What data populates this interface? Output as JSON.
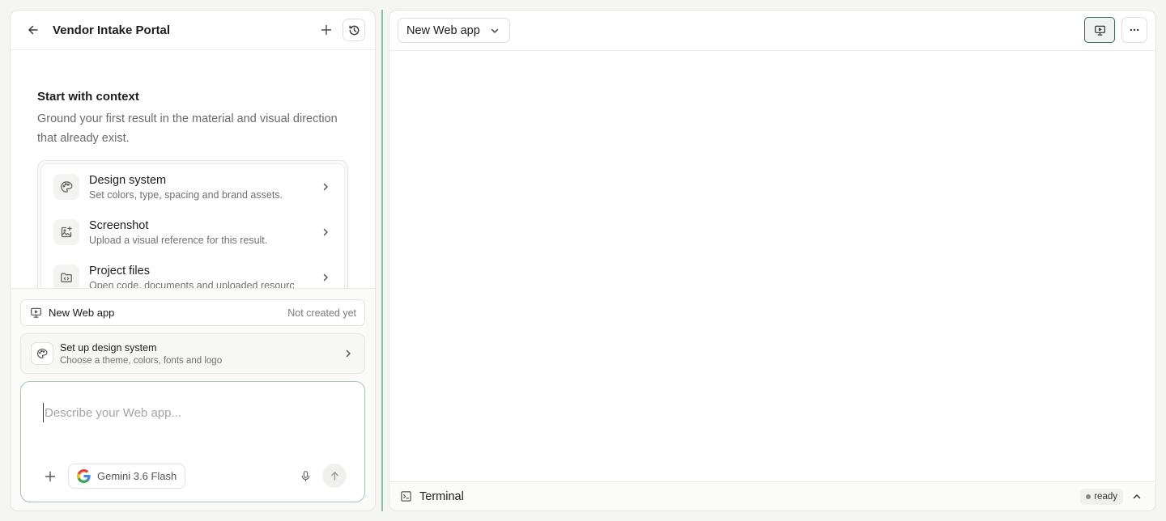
{
  "project": {
    "title": "Vendor Intake Portal"
  },
  "context": {
    "heading": "Start with context",
    "description": "Ground your first result in the material and visual direction that already exist.",
    "items": [
      {
        "title": "Design system",
        "subtitle": "Set colors, type, spacing and brand assets.",
        "icon": "palette-icon"
      },
      {
        "title": "Screenshot",
        "subtitle": "Upload a visual reference for this result.",
        "icon": "image-add-icon"
      },
      {
        "title": "Project files",
        "subtitle": "Open code, documents and uploaded resourc",
        "icon": "folder-code-icon"
      }
    ]
  },
  "status": {
    "name": "New Web app",
    "state": "Not created yet"
  },
  "setup": {
    "title": "Set up design system",
    "subtitle": "Choose a theme, colors, fonts and logo"
  },
  "prompt": {
    "placeholder": "Describe your Web app...",
    "model": "Gemini 3.6 Flash"
  },
  "preview": {
    "app_selector": "New Web app"
  },
  "terminal": {
    "label": "Terminal",
    "status": "ready"
  }
}
